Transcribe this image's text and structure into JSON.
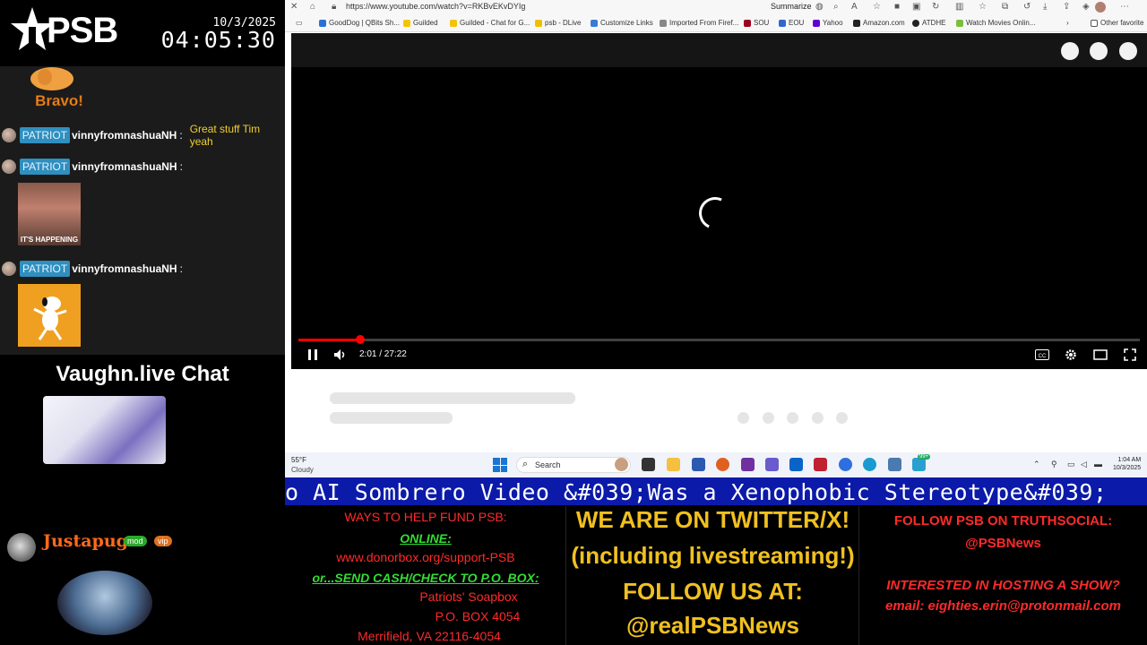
{
  "overlay": {
    "brand": "PSB",
    "date": "10/3/2025",
    "clock": "04:05:30"
  },
  "chat": {
    "bravo_text": "Bravo!",
    "messages": [
      {
        "badge": "PATRIOT",
        "user": "vinnyfromnashuaNH",
        "sep": ":",
        "text": "Great stuff Tim yeah"
      },
      {
        "badge": "PATRIOT",
        "user": "vinnyfromnashuaNH",
        "sep": ":",
        "text": ""
      },
      {
        "badge": "PATRIOT",
        "user": "vinnyfromnashuaNH",
        "sep": ":",
        "text": ""
      }
    ],
    "gif1_caption": "IT'S HAPPENING"
  },
  "vaughn": {
    "title": "Vaughn.live Chat",
    "user": "Justapug",
    "badge_mod": "mod",
    "badge_vip": "vip"
  },
  "browser": {
    "url": "https://www.youtube.com/watch?v=RKBvEKvDYIg",
    "summarize": "Summarize",
    "bookmarks": [
      {
        "label": "GoodDog | QBits Sh...",
        "color": "#2a6fd6"
      },
      {
        "label": "Guilded",
        "color": "#f5c400"
      },
      {
        "label": "Guilded - Chat for G...",
        "color": "#f5c400"
      },
      {
        "label": "psb - DLive",
        "color": "#f0c000"
      },
      {
        "label": "Customize Links",
        "color": "#3a7bd5"
      },
      {
        "label": "Imported From Firef...",
        "color": "#888888"
      },
      {
        "label": "SOU",
        "color": "#a00020"
      },
      {
        "label": "EOU",
        "color": "#3366cc"
      },
      {
        "label": "Yahoo",
        "color": "#6001d2"
      },
      {
        "label": "Amazon.com",
        "color": "#222222"
      },
      {
        "label": "ATDHE",
        "color": "#222222"
      },
      {
        "label": "Watch Movies Onlin...",
        "color": "#7bbf3a"
      }
    ],
    "other_favorites": "Other favorite"
  },
  "player": {
    "time": "2:01 / 27:22",
    "progress_fraction": 0.074
  },
  "taskbar": {
    "temp": "55°F",
    "weather": "Cloudy",
    "search": "Search",
    "time": "1:04 AM",
    "date": "10/3/2025",
    "notif": "99+"
  },
  "ticker": {
    "text": "o AI Sombrero Video &#039;Was a Xenophobic Stereotype&#039;"
  },
  "footer": {
    "left": {
      "l1": "WAYS TO HELP FUND PSB:",
      "l2": "ONLINE:",
      "l3": "www.donorbox.org/support-PSB",
      "l4": "or...SEND CASH/CHECK TO P.O. BOX:",
      "l5": "Patriots' Soapbox",
      "l6": "P.O. BOX 4054",
      "l7": "Merrifield, VA 22116-4054"
    },
    "mid": {
      "l1": "WE ARE ON TWITTER/X!",
      "l2": "(including livestreaming!)",
      "l3": "FOLLOW US AT:",
      "l4": "@realPSBNews"
    },
    "right": {
      "l1": "FOLLOW PSB ON TRUTHSOCIAL:",
      "l2": "@PSBNews",
      "l3": "INTERESTED IN HOSTING A SHOW?",
      "l4": "email: eighties.erin@protonmail.com"
    }
  }
}
